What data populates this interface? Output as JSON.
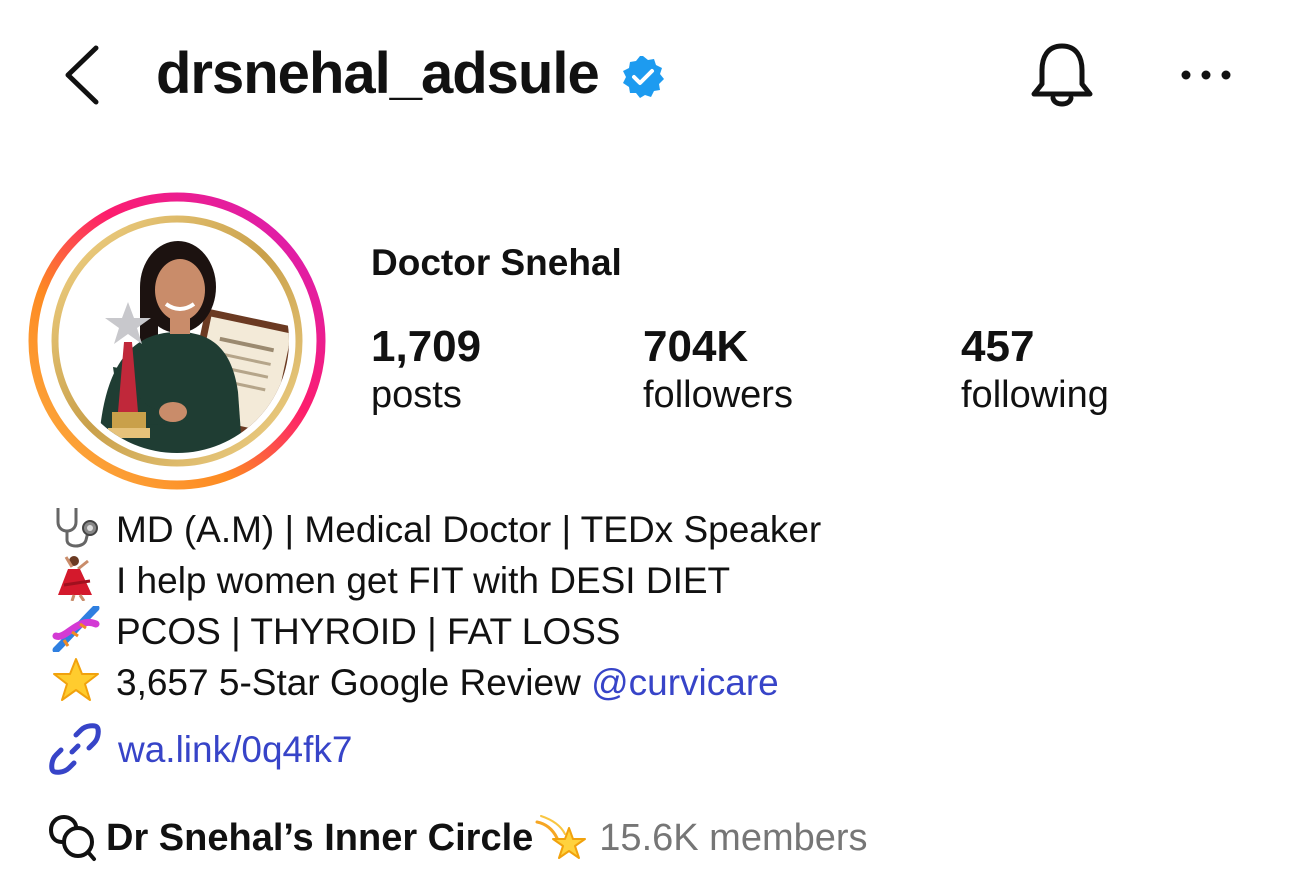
{
  "header": {
    "username": "drsnehal_adsule",
    "back_icon": "chevron-left-icon",
    "verified_icon": "verified-badge-icon",
    "notifications_icon": "bell-icon",
    "more_icon": "more-horizontal-icon"
  },
  "profile": {
    "display_name": "Doctor Snehal",
    "avatar_icon": "profile-photo-avatar"
  },
  "stats": {
    "posts": {
      "count": "1,709",
      "label": "posts"
    },
    "followers": {
      "count": "704K",
      "label": "followers"
    },
    "following": {
      "count": "457",
      "label": "following"
    }
  },
  "bio": {
    "lines": [
      {
        "icon": "stethoscope-icon",
        "text": "MD (A.M) | Medical Doctor | TEDx Speaker"
      },
      {
        "icon": "dancer-icon",
        "text": "I help women get FIT with DESI DIET"
      },
      {
        "icon": "dna-icon",
        "text": "PCOS | THYROID | FAT LOSS"
      },
      {
        "icon": "star-icon",
        "text": "3,657 5-Star Google Review ",
        "mention": "@curvicare"
      }
    ],
    "link": {
      "icon": "link-icon",
      "text": "wa.link/0q4fk7"
    }
  },
  "channel": {
    "icon": "broadcast-channel-icon",
    "name": "Dr Snehal’s Inner Circle",
    "emoji_icon": "dizzy-star-icon",
    "members": "15.6K members"
  },
  "colors": {
    "link": "#3744c8",
    "verified": "#1d9bf0",
    "muted": "#767676",
    "text": "#111111"
  }
}
